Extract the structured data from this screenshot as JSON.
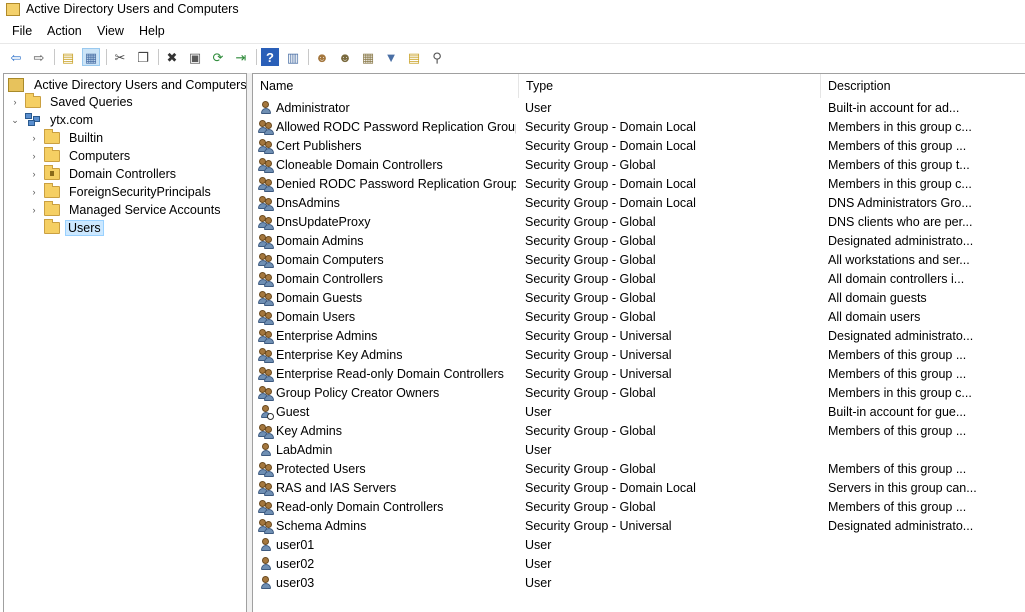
{
  "window": {
    "title": "Active Directory Users and Computers"
  },
  "menu": [
    "File",
    "Action",
    "View",
    "Help"
  ],
  "toolbar": [
    {
      "icon": "back-arrow-icon",
      "glyph": "⇦",
      "color": "#2a6fc9"
    },
    {
      "icon": "forward-arrow-icon",
      "glyph": "⇨",
      "color": "#555555"
    },
    {
      "sep": true
    },
    {
      "icon": "up-folder-icon",
      "glyph": "▤",
      "color": "#c9a227"
    },
    {
      "icon": "show-console-tree-icon",
      "glyph": "▦",
      "color": "#4a6fa5",
      "pressed": true
    },
    {
      "sep": true
    },
    {
      "icon": "cut-icon",
      "glyph": "✂",
      "color": "#444444"
    },
    {
      "icon": "copy-icon",
      "glyph": "❐",
      "color": "#444444"
    },
    {
      "sep": true
    },
    {
      "icon": "delete-icon",
      "glyph": "✖",
      "color": "#333333"
    },
    {
      "icon": "properties-icon",
      "glyph": "▣",
      "color": "#5a5a5a"
    },
    {
      "icon": "refresh-icon",
      "glyph": "⟳",
      "color": "#2e8b3a"
    },
    {
      "icon": "export-list-icon",
      "glyph": "⇥",
      "color": "#2e8b3a"
    },
    {
      "sep": true
    },
    {
      "icon": "help-icon",
      "glyph": "?",
      "color": "#ffffff",
      "bg": "#2a5fb8"
    },
    {
      "icon": "show-hide-action-pane-icon",
      "glyph": "▥",
      "color": "#4a6fa5"
    },
    {
      "sep": true
    },
    {
      "icon": "new-user-icon",
      "glyph": "☻",
      "color": "#a4773e"
    },
    {
      "icon": "new-group-icon",
      "glyph": "☻",
      "color": "#7a6a3e"
    },
    {
      "icon": "new-ou-icon",
      "glyph": "▦",
      "color": "#8a7a4a"
    },
    {
      "icon": "filter-icon",
      "glyph": "▼",
      "color": "#4a6fa5"
    },
    {
      "icon": "add-to-group-icon",
      "glyph": "▤",
      "color": "#c9a227"
    },
    {
      "icon": "find-objects-icon",
      "glyph": "⚲",
      "color": "#555555"
    }
  ],
  "tree": {
    "root": "Active Directory Users and Computers [Al",
    "items": [
      {
        "label": "Saved Queries",
        "level": 1,
        "expander": "›",
        "icon": "folder"
      },
      {
        "label": "ytx.com",
        "level": 1,
        "expander": "⌄",
        "icon": "domain"
      },
      {
        "label": "Builtin",
        "level": 2,
        "expander": "›",
        "icon": "folder"
      },
      {
        "label": "Computers",
        "level": 2,
        "expander": "›",
        "icon": "folder"
      },
      {
        "label": "Domain Controllers",
        "level": 2,
        "expander": "›",
        "icon": "folder-special"
      },
      {
        "label": "ForeignSecurityPrincipals",
        "level": 2,
        "expander": "›",
        "icon": "folder"
      },
      {
        "label": "Managed Service Accounts",
        "level": 2,
        "expander": "›",
        "icon": "folder"
      },
      {
        "label": "Users",
        "level": 2,
        "expander": "",
        "icon": "folder",
        "selected": true
      }
    ]
  },
  "columns": [
    "Name",
    "Type",
    "Description"
  ],
  "rows": [
    {
      "name": "Administrator",
      "type": "User",
      "description": "Built-in account for ad...",
      "kind": "user"
    },
    {
      "name": "Allowed RODC Password Replication Group",
      "type": "Security Group - Domain Local",
      "description": "Members in this group c...",
      "kind": "group"
    },
    {
      "name": "Cert Publishers",
      "type": "Security Group - Domain Local",
      "description": "Members of this group ...",
      "kind": "group"
    },
    {
      "name": "Cloneable Domain Controllers",
      "type": "Security Group - Global",
      "description": "Members of this group t...",
      "kind": "group"
    },
    {
      "name": "Denied RODC Password Replication Group",
      "type": "Security Group - Domain Local",
      "description": "Members in this group c...",
      "kind": "group"
    },
    {
      "name": "DnsAdmins",
      "type": "Security Group - Domain Local",
      "description": "DNS Administrators Gro...",
      "kind": "group"
    },
    {
      "name": "DnsUpdateProxy",
      "type": "Security Group - Global",
      "description": "DNS clients who are per...",
      "kind": "group"
    },
    {
      "name": "Domain Admins",
      "type": "Security Group - Global",
      "description": "Designated administrato...",
      "kind": "group"
    },
    {
      "name": "Domain Computers",
      "type": "Security Group - Global",
      "description": "All workstations and ser...",
      "kind": "group"
    },
    {
      "name": "Domain Controllers",
      "type": "Security Group - Global",
      "description": "All domain controllers i...",
      "kind": "group"
    },
    {
      "name": "Domain Guests",
      "type": "Security Group - Global",
      "description": "All domain guests",
      "kind": "group"
    },
    {
      "name": "Domain Users",
      "type": "Security Group - Global",
      "description": "All domain users",
      "kind": "group"
    },
    {
      "name": "Enterprise Admins",
      "type": "Security Group - Universal",
      "description": "Designated administrato...",
      "kind": "group"
    },
    {
      "name": "Enterprise Key Admins",
      "type": "Security Group - Universal",
      "description": "Members of this group ...",
      "kind": "group"
    },
    {
      "name": "Enterprise Read-only Domain Controllers",
      "type": "Security Group - Universal",
      "description": "Members of this group ...",
      "kind": "group"
    },
    {
      "name": "Group Policy Creator Owners",
      "type": "Security Group - Global",
      "description": "Members in this group c...",
      "kind": "group"
    },
    {
      "name": "Guest",
      "type": "User",
      "description": "Built-in account for gue...",
      "kind": "user-disabled"
    },
    {
      "name": "Key Admins",
      "type": "Security Group - Global",
      "description": "Members of this group ...",
      "kind": "group"
    },
    {
      "name": "LabAdmin",
      "type": "User",
      "description": "",
      "kind": "user"
    },
    {
      "name": "Protected Users",
      "type": "Security Group - Global",
      "description": "Members of this group ...",
      "kind": "group"
    },
    {
      "name": "RAS and IAS Servers",
      "type": "Security Group - Domain Local",
      "description": "Servers in this group can...",
      "kind": "group"
    },
    {
      "name": "Read-only Domain Controllers",
      "type": "Security Group - Global",
      "description": "Members of this group ...",
      "kind": "group"
    },
    {
      "name": "Schema Admins",
      "type": "Security Group - Universal",
      "description": "Designated administrato...",
      "kind": "group"
    },
    {
      "name": "user01",
      "type": "User",
      "description": "",
      "kind": "user"
    },
    {
      "name": "user02",
      "type": "User",
      "description": "",
      "kind": "user"
    },
    {
      "name": "user03",
      "type": "User",
      "description": "",
      "kind": "user"
    }
  ]
}
